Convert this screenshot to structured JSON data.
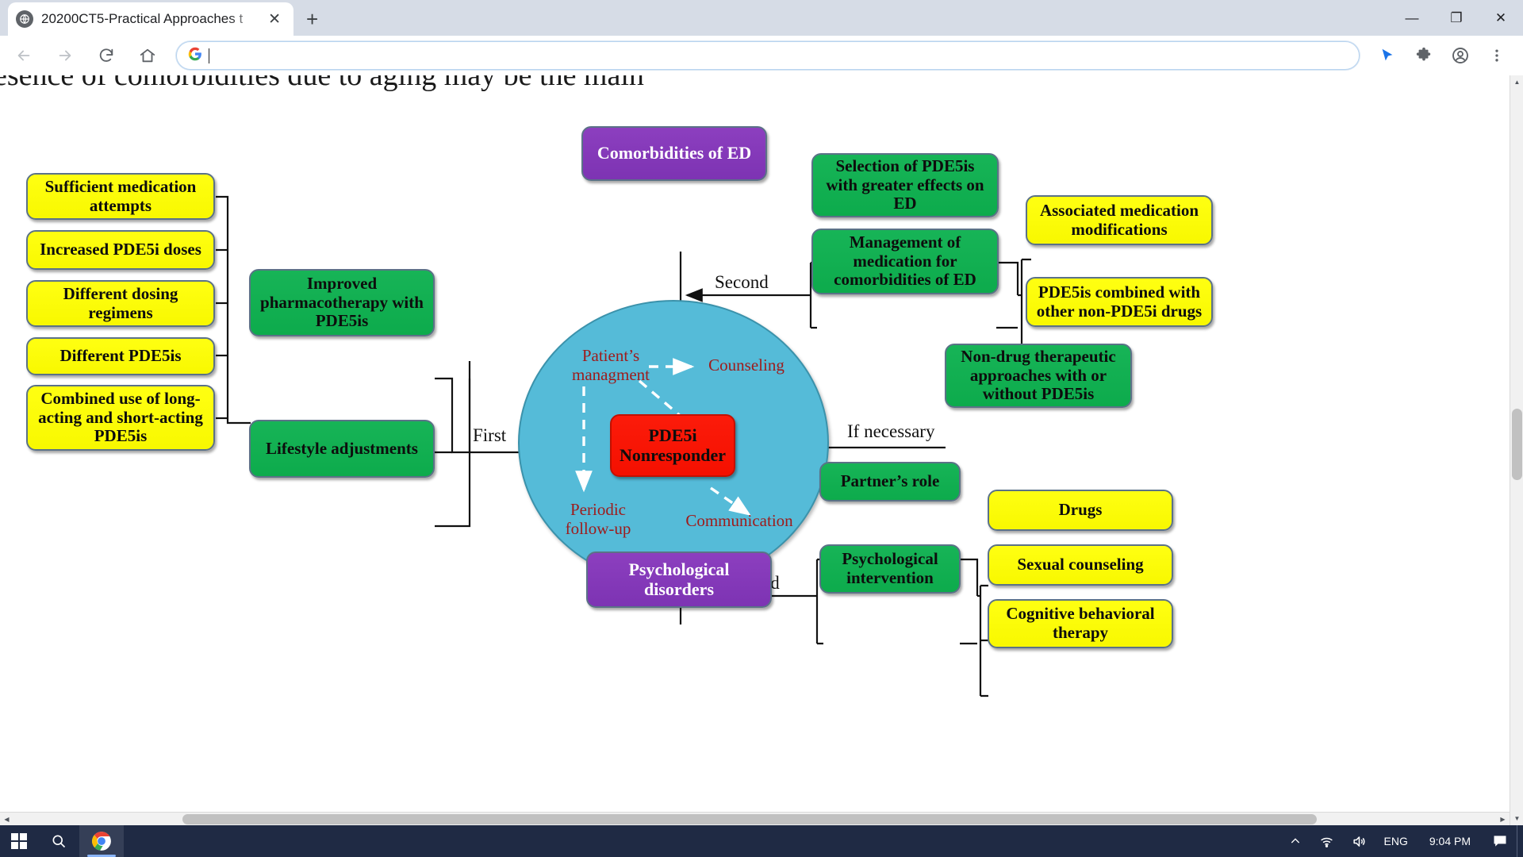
{
  "browser": {
    "tab": {
      "title": "20200CT5-Practical Approaches t",
      "favicon_icon": "globe-icon",
      "close_icon": "close-icon"
    },
    "new_tab_label": "+",
    "window_controls": {
      "minimize": "—",
      "maximize": "❐",
      "close": "✕"
    },
    "toolbar": {
      "back_icon": "arrow-left-icon",
      "forward_icon": "arrow-right-icon",
      "reload_icon": "reload-icon",
      "home_icon": "home-icon",
      "omnibox_value": "",
      "omnibox_placeholder": "",
      "search_engine_icon": "google-g-icon",
      "cursor_icon": "cursor-icon",
      "extensions_icon": "puzzle-piece-icon",
      "profile_icon": "account-circle-icon",
      "menu_icon": "three-dot-menu-icon"
    }
  },
  "page": {
    "cut_off_heading": "esence of comorbidities due to aging may be the main"
  },
  "diagram": {
    "center": {
      "ellipse_labels": [
        "Patient’s managment",
        "Counseling",
        "Periodic follow-up",
        "Communication"
      ],
      "core_node": "PDE5i Nonresponder"
    },
    "edge_labels": {
      "first": "First",
      "second_top": "Second",
      "second_bottom": "Second",
      "if_necessary": "If necessary"
    },
    "left_branch": {
      "leaves": [
        "Sufficient medication attempts",
        "Increased PDE5i doses",
        "Different dosing regimens",
        "Different PDE5is",
        "Combined use of long-acting and short-acting PDE5is"
      ],
      "groups": [
        "Improved pharmacotherapy with PDE5is",
        "Lifestyle adjustments"
      ]
    },
    "top_branch": {
      "source": "Comorbidities of ED",
      "groups": [
        "Selection of PDE5is with greater effects on ED",
        "Management of medication for comorbidities of ED"
      ],
      "leaves": [
        "Associated medication modifications",
        "PDE5is combined with other non-PDE5i drugs"
      ]
    },
    "right_branch": {
      "node": "Non-drug therapeutic approaches with or without PDE5is"
    },
    "bottom_branch": {
      "source": "Psychological disorders",
      "groups": [
        "Partner’s role",
        "Psychological intervention"
      ],
      "leaves": [
        "Drugs",
        "Sexual counseling",
        "Cognitive behavioral therapy"
      ]
    },
    "colors": {
      "yellow": "#ffff00",
      "green": "#12b055",
      "purple": "#8c3fbf",
      "red": "#f41000",
      "ellipse": "#55bbd8",
      "label_red": "#9e1b1b"
    }
  },
  "taskbar": {
    "start_icon": "windows-logo-icon",
    "search_icon": "search-icon",
    "chrome_icon": "chrome-icon",
    "show_hidden_icon": "chevron-up-icon",
    "network_icon": "wifi-icon",
    "volume_icon": "speaker-icon",
    "language": "ENG",
    "clock": "9:04 PM",
    "notifications_icon": "speech-bubble-icon"
  }
}
